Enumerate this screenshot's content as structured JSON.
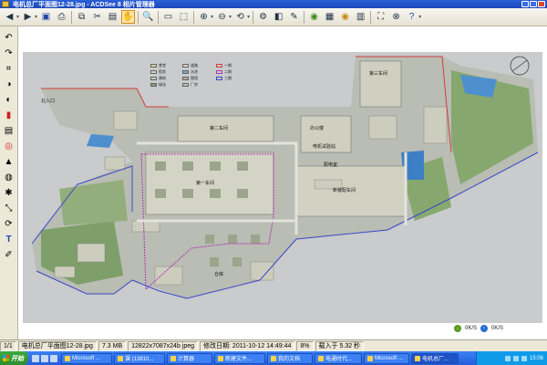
{
  "window": {
    "title": "电机总厂平面图12-28.jpg - ACDSee 8 相片管理器"
  },
  "toolbar": {
    "icons": [
      "back-icon",
      "forward-icon",
      "save-icon",
      "print-icon",
      "copy-icon",
      "cut-icon",
      "paste-icon",
      "hand-icon",
      "zoom-icon",
      "zoom-in-icon",
      "zoom-out-icon",
      "rotate-icon",
      "acquire-icon",
      "view-icon",
      "edit-icon",
      "slideshow-icon",
      "wallpaper-icon",
      "full-screen-icon",
      "help-icon"
    ]
  },
  "viewer": {
    "legend": [
      {
        "label": "食堂",
        "color": "#d9cf9a"
      },
      {
        "label": "宿舍",
        "color": "#cfd8b0"
      },
      {
        "label": "建筑",
        "color": "#c5c6b2"
      },
      {
        "label": "绿化",
        "color": "#7fa36a"
      },
      {
        "label": "道路",
        "color": "#d7d7cf"
      },
      {
        "label": "水池",
        "color": "#6ea7d6"
      },
      {
        "label": "围墙",
        "color": "#a9a9a9"
      },
      {
        "label": "厂房",
        "color": "#bdbfae"
      },
      {
        "label": "一期",
        "color": "#d43d3d"
      },
      {
        "label": "二期",
        "color": "#b237b2"
      },
      {
        "label": "三期",
        "color": "#3b47c9"
      }
    ],
    "buildings": [
      {
        "label": "第三车间"
      },
      {
        "label": "第二车间"
      },
      {
        "label": "第一车间"
      },
      {
        "label": "新装配车间"
      },
      {
        "label": "仓库"
      },
      {
        "label": "办公楼"
      },
      {
        "label": "电机试验站"
      },
      {
        "label": "配电室"
      },
      {
        "label": "北入口"
      }
    ],
    "pager": {
      "text1": "0K/S",
      "text2": "0K/S"
    }
  },
  "statusbar": {
    "index": "1/1",
    "filename": "电机总厂平面图12-28.jpg",
    "filesize": "7.3 MB",
    "dimensions": "12822x7087x24b jpeg",
    "modified": "修改日期: 2011-10-12 14:49:44",
    "zoom": "8%",
    "load_time": "载入于 5.32 秒"
  },
  "taskbar": {
    "start_label": "开始",
    "tasks": [
      {
        "label": "Microsoft ..."
      },
      {
        "label": "课 (13810..."
      },
      {
        "label": "计算器"
      },
      {
        "label": "新建文件..."
      },
      {
        "label": "我的文档"
      },
      {
        "label": "电通时代..."
      },
      {
        "label": "Microsoft ..."
      },
      {
        "label": "电机总厂..."
      }
    ],
    "clock": "15:06"
  }
}
